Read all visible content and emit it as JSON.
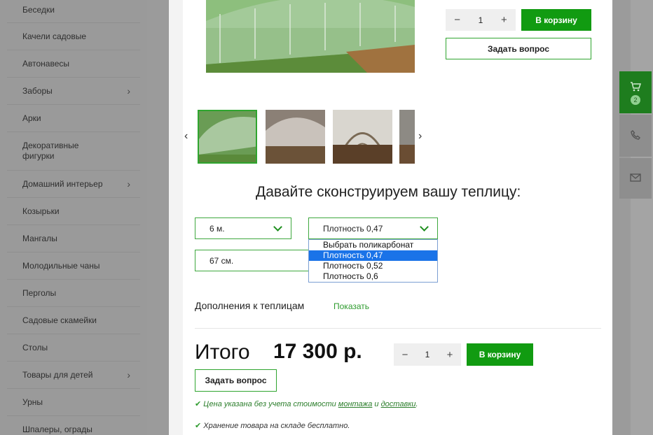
{
  "sidebar": {
    "items": [
      {
        "label": "Беседки",
        "has_submenu": false
      },
      {
        "label": "Качели садовые",
        "has_submenu": false
      },
      {
        "label": "Автонавесы",
        "has_submenu": false
      },
      {
        "label": "Заборы",
        "has_submenu": true
      },
      {
        "label": "Арки",
        "has_submenu": false
      },
      {
        "label": "Декоративные фигурки",
        "has_submenu": false
      },
      {
        "label": "Домашний интерьер",
        "has_submenu": true
      },
      {
        "label": "Козырьки",
        "has_submenu": false
      },
      {
        "label": "Мангалы",
        "has_submenu": false
      },
      {
        "label": "Молодильные чаны",
        "has_submenu": false
      },
      {
        "label": "Перголы",
        "has_submenu": false
      },
      {
        "label": "Садовые скамейки",
        "has_submenu": false
      },
      {
        "label": "Столы",
        "has_submenu": false
      },
      {
        "label": "Товары для детей",
        "has_submenu": true
      },
      {
        "label": "Урны",
        "has_submenu": false
      },
      {
        "label": "Шпалеры, ограды",
        "has_submenu": false
      }
    ],
    "chevron": "›"
  },
  "floating_panel": {
    "cart_icon": "cart-icon",
    "cart_count": "2",
    "phone_icon": "phone-icon",
    "mail_icon": "mail-icon",
    "active_color": "#1e7d1e"
  },
  "top_actions": {
    "qty_minus": "−",
    "qty_value": "1",
    "qty_plus": "+",
    "add_to_cart": "В корзину",
    "ask_question": "Задать вопрос"
  },
  "gallery": {
    "prev": "‹",
    "next": "›"
  },
  "constructor": {
    "heading": "Давайте сконструируем вашу теплицу:",
    "length_select": "6 м.",
    "density_select": "Плотность 0,47",
    "step_select": "67 см.",
    "density_options": [
      "Выбрать поликарбонат",
      "Плотность 0,47",
      "Плотность 0,52",
      "Плотность 0,6"
    ],
    "selected_option": "Плотность 0,47"
  },
  "addons": {
    "label": "Дополнения к теплицам",
    "show_link": "Показать"
  },
  "total": {
    "label": "Итого",
    "price": "17 300 р.",
    "qty_minus": "−",
    "qty_value": "1",
    "qty_plus": "+",
    "add_to_cart": "В корзину",
    "ask_question": "Задать вопрос"
  },
  "notes": {
    "check": "✔",
    "price_note_prefix": "Цена указана без учета стоимости ",
    "link_mounting": "монтажа",
    "and": " и ",
    "link_delivery": "доставки",
    "period": ".",
    "storage_note": "Хранение товара на складе бесплатно."
  },
  "colors": {
    "brand_green": "#119b11",
    "accent_green": "#2e9b2e",
    "highlight_blue": "#1a73e8"
  }
}
